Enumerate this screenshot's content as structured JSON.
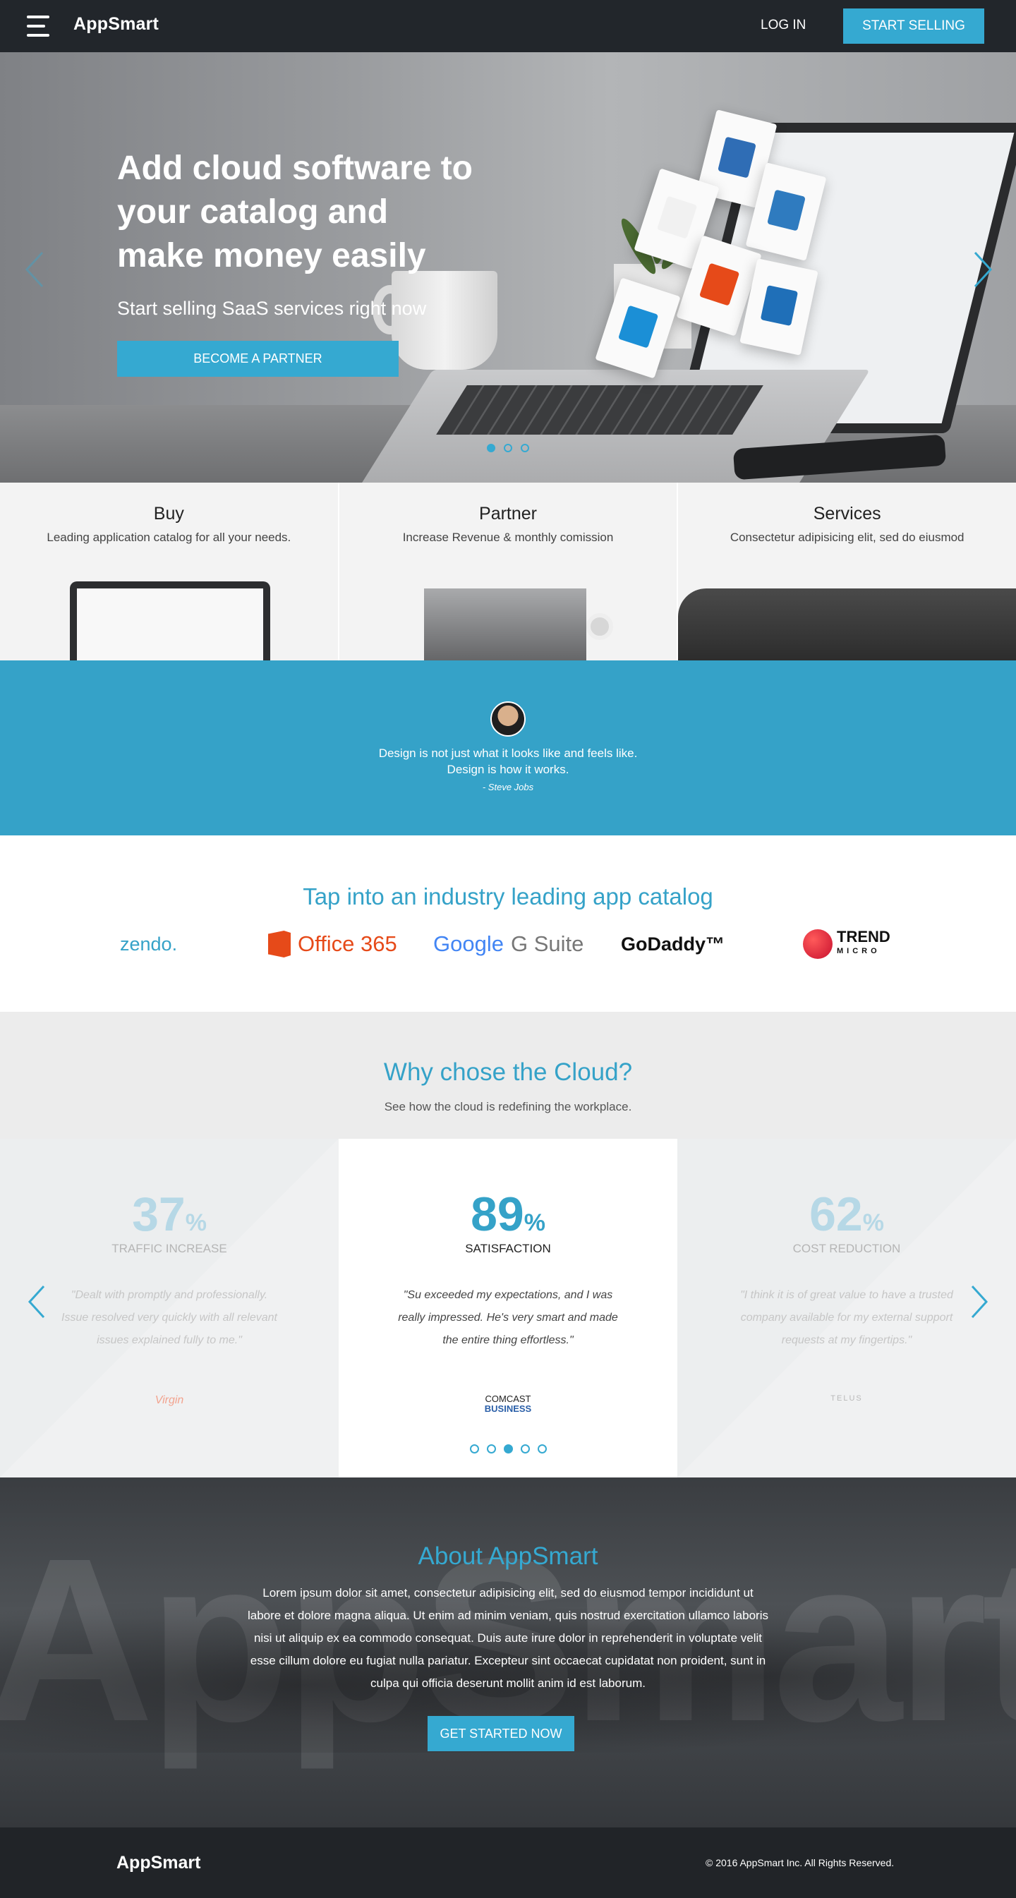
{
  "nav": {
    "brand": "AppSmart",
    "login": "LOG IN",
    "cta": "START SELLING"
  },
  "hero": {
    "title": "Add cloud software to your catalog and make money easily",
    "subtitle": "Start selling SaaS services right now",
    "button": "BECOME A PARTNER",
    "slides": 3,
    "active_slide": 0
  },
  "panels": [
    {
      "title": "Buy",
      "text": "Leading application catalog for all your needs."
    },
    {
      "title": "Partner",
      "text": "Increase Revenue & monthly comission"
    },
    {
      "title": "Services",
      "text": "Consectetur adipisicing elit, sed do eiusmod"
    }
  ],
  "quote": {
    "line1": "Design is not just what it looks like and feels like.",
    "line2": "Design is how it works.",
    "author": "- Steve Jobs"
  },
  "catalog": {
    "title": "Tap into an industry leading app catalog",
    "logos": {
      "zendo": "zendo.",
      "office": "Office 365",
      "google": "Google",
      "gsuite": "G Suite",
      "godaddy": "GoDaddy™",
      "trend": "TREND",
      "micro": "MICRO"
    }
  },
  "why": {
    "title": "Why chose the Cloud?",
    "subtitle": "See how the cloud is redefining the workplace.",
    "stats": [
      {
        "value": "37",
        "unit": "%",
        "label": "TRAFFIC INCREASE",
        "quote": "\"Dealt with promptly and professionally. Issue resolved very quickly with all relevant issues explained fully to me.\"",
        "logo": "Virgin"
      },
      {
        "value": "89",
        "unit": "%",
        "label": "SATISFACTION",
        "quote": "\"Su exceeded my expectations, and I was really impressed. He's very smart and made the entire thing effortless.\"",
        "logo_line1": "COMCAST",
        "logo_line2": "BUSINESS"
      },
      {
        "value": "62",
        "unit": "%",
        "label": "COST REDUCTION",
        "quote": "\"I think it is of great value to have a trusted company available for my external support requests at my fingertips.\"",
        "logo": "TELUS"
      }
    ],
    "dots": 5,
    "active_dot": 2
  },
  "about": {
    "watermark": "AppSmart",
    "title": "About AppSmart",
    "text": "Lorem ipsum dolor sit amet, consectetur adipisicing elit, sed do eiusmod tempor incididunt ut labore et dolore magna aliqua. Ut enim ad minim veniam, quis nostrud exercitation ullamco laboris nisi ut aliquip ex ea commodo consequat. Duis aute irure dolor in reprehenderit in voluptate velit esse cillum dolore eu fugiat nulla pariatur. Excepteur sint occaecat cupidatat non proident, sunt in culpa qui officia deserunt mollit anim id est laborum.",
    "button": "GET STARTED NOW"
  },
  "footer": {
    "brand": "AppSmart",
    "copyright": "© 2016 AppSmart Inc.  All Rights Reserved."
  },
  "colors": {
    "accent": "#35a9d1",
    "dark": "#22262b",
    "quote_bg": "#35a2c8"
  }
}
